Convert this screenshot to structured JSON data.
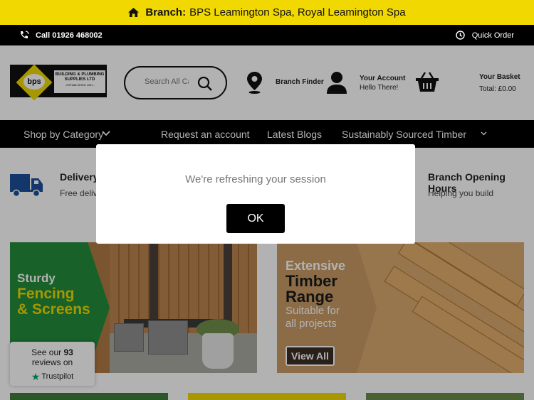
{
  "branch_bar": {
    "label": "Branch:",
    "value": "BPS Leamington Spa, Royal Leamington Spa"
  },
  "topbar": {
    "phone": "Call 01926 468002",
    "quick_order": "Quick Order"
  },
  "logo": {
    "mark": "bps",
    "line1": "BUILDING & PLUMBING",
    "line2": "SUPPLIES LTD",
    "line3": "- ESTABLISHED 1991 -"
  },
  "search": {
    "placeholder": "Search All Categories"
  },
  "header": {
    "branch_finder": "Branch Finder",
    "account_title": "Your Account",
    "account_sub": "Hello There!",
    "basket_title": "Your Basket",
    "basket_total": "Total: £0.00"
  },
  "nav": {
    "shop": "Shop by Category",
    "items": [
      "Request an account",
      "Latest Blogs",
      "Sustainably Sourced Timber"
    ]
  },
  "features": {
    "delivery_title": "Delivery",
    "delivery_sub": "Free deliv",
    "hours_title": "Branch Opening Hours",
    "hours_sub": "Helping you build"
  },
  "banner_fencing": {
    "line1": "Sturdy",
    "line2": "Fencing",
    "line3": "& Screens"
  },
  "banner_timber": {
    "line1": "Extensive",
    "line2": "Timber",
    "line3": "Range",
    "line4": "Suitable for",
    "line5": "all projects",
    "cta": "View All"
  },
  "trustpilot": {
    "prefix": "See our",
    "count": "93",
    "suffix": "reviews on",
    "brand": "Trustpilot"
  },
  "modal": {
    "message": "We're refreshing your session",
    "button": "OK"
  },
  "colors": {
    "accent": "#f0d800",
    "dark": "#000000",
    "green": "#238c3c"
  }
}
